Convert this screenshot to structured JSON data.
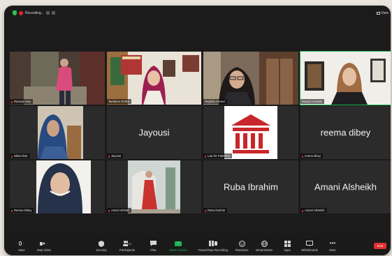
{
  "topbar": {
    "recording_label": "Recording...",
    "view_label": "View"
  },
  "participants": [
    {
      "name": "Razwan Issa",
      "muted": true
    },
    {
      "name": "Tamkeen Online",
      "muted": false
    },
    {
      "name": "Raghda Asmed",
      "muted": false
    },
    {
      "name": "Rawan Hussein",
      "muted": false,
      "speaking": true
    },
    {
      "name": "Nibal Alaiv",
      "muted": true
    },
    {
      "name": "Jayousi",
      "muted": true,
      "big_name": "Jayousi"
    },
    {
      "name": "Law for Palestine",
      "muted": true
    },
    {
      "name": "reema dibey",
      "muted": true,
      "big_name": "reema dibey"
    },
    {
      "name": "Reema Dibey",
      "muted": true
    },
    {
      "name": "Aseel Ashhab",
      "muted": true
    },
    {
      "name": "Ruba Ibrahim",
      "muted": true,
      "big_name": "Ruba Ibrahim"
    },
    {
      "name": "Amani Alsheikh",
      "muted": true,
      "big_name": "Amani Alsheikh"
    }
  ],
  "toolbar": {
    "mute": "Mute",
    "stop_video": "Stop Video",
    "security": "Security",
    "participants": "Participants",
    "participants_count": "12",
    "chat": "Chat",
    "share_screen": "Share Screen",
    "recording": "Pause/Stop Recording",
    "reactions": "Reactions",
    "interpretation": "Interpretation",
    "apps": "Apps",
    "whiteboards": "Whiteboards",
    "more": "More",
    "end": "End"
  },
  "colors": {
    "share_green": "#1fb35a",
    "end_red": "#e02f2f",
    "speaking_outline": "#1db954",
    "logo_red": "#c8262a"
  },
  "icons": [
    "shield-icon",
    "record-dot-icon",
    "grid-view-icon",
    "mic-icon",
    "video-camera-icon",
    "security-shield-icon",
    "participants-icon",
    "chat-icon",
    "share-screen-icon",
    "record-icon",
    "reactions-icon",
    "interpretation-globe-icon",
    "apps-icon",
    "whiteboard-icon",
    "more-icon"
  ]
}
